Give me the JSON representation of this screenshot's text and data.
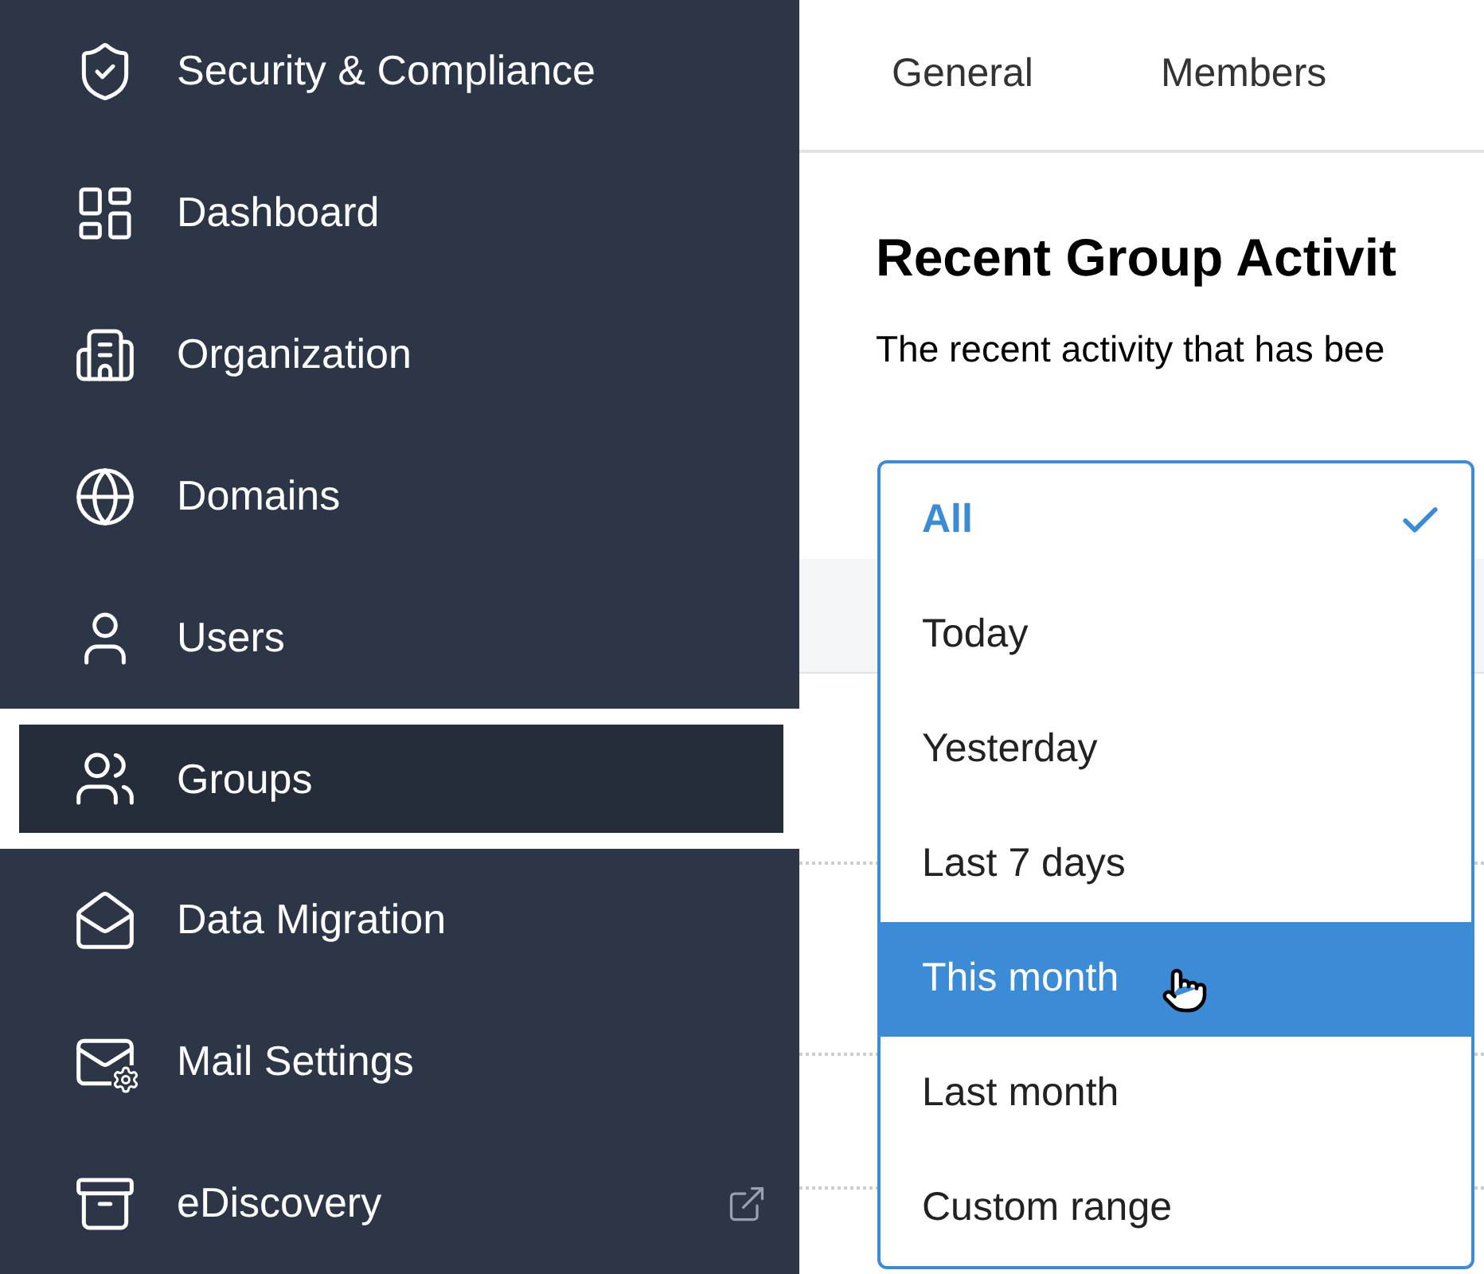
{
  "sidebar": {
    "items": [
      {
        "label": "Security & Compliance",
        "selected": false,
        "external": false
      },
      {
        "label": "Dashboard",
        "selected": false,
        "external": false
      },
      {
        "label": "Organization",
        "selected": false,
        "external": false
      },
      {
        "label": "Domains",
        "selected": false,
        "external": false
      },
      {
        "label": "Users",
        "selected": false,
        "external": false
      },
      {
        "label": "Groups",
        "selected": true,
        "external": false
      },
      {
        "label": "Data Migration",
        "selected": false,
        "external": false
      },
      {
        "label": "Mail Settings",
        "selected": false,
        "external": false
      },
      {
        "label": "eDiscovery",
        "selected": false,
        "external": true
      }
    ]
  },
  "tabs": [
    {
      "label": "General",
      "selected": false
    },
    {
      "label": "Members",
      "selected": false
    }
  ],
  "title": "Recent Group Activit",
  "description": "The recent activity that has bee",
  "dropdown": {
    "options": [
      {
        "label": "All",
        "selected": true,
        "hovered": false
      },
      {
        "label": "Today",
        "selected": false,
        "hovered": false
      },
      {
        "label": "Yesterday",
        "selected": false,
        "hovered": false
      },
      {
        "label": "Last 7 days",
        "selected": false,
        "hovered": false
      },
      {
        "label": "This month",
        "selected": false,
        "hovered": true
      },
      {
        "label": "Last month",
        "selected": false,
        "hovered": false
      },
      {
        "label": "Custom range",
        "selected": false,
        "hovered": false
      }
    ]
  }
}
